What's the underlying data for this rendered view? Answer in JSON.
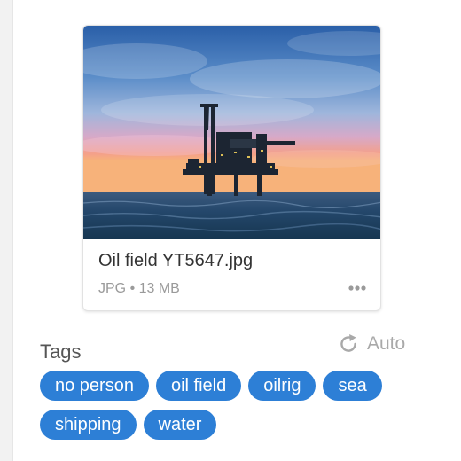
{
  "file": {
    "name": "Oil field YT5647.jpg",
    "meta": "JPG • 13 MB",
    "thumbnail_icon": "offshore-oil-rig-photo"
  },
  "actions": {
    "more_icon": "ellipsis-icon",
    "auto_icon": "refresh-icon",
    "auto_label": "Auto"
  },
  "tags": {
    "label": "Tags",
    "items": [
      "no person",
      "oil field",
      "oilrig",
      "sea",
      "shipping",
      "water"
    ]
  },
  "colors": {
    "tag_bg": "#2d7fd6",
    "tag_text": "#ffffff",
    "muted_text": "#9a9a9a"
  }
}
